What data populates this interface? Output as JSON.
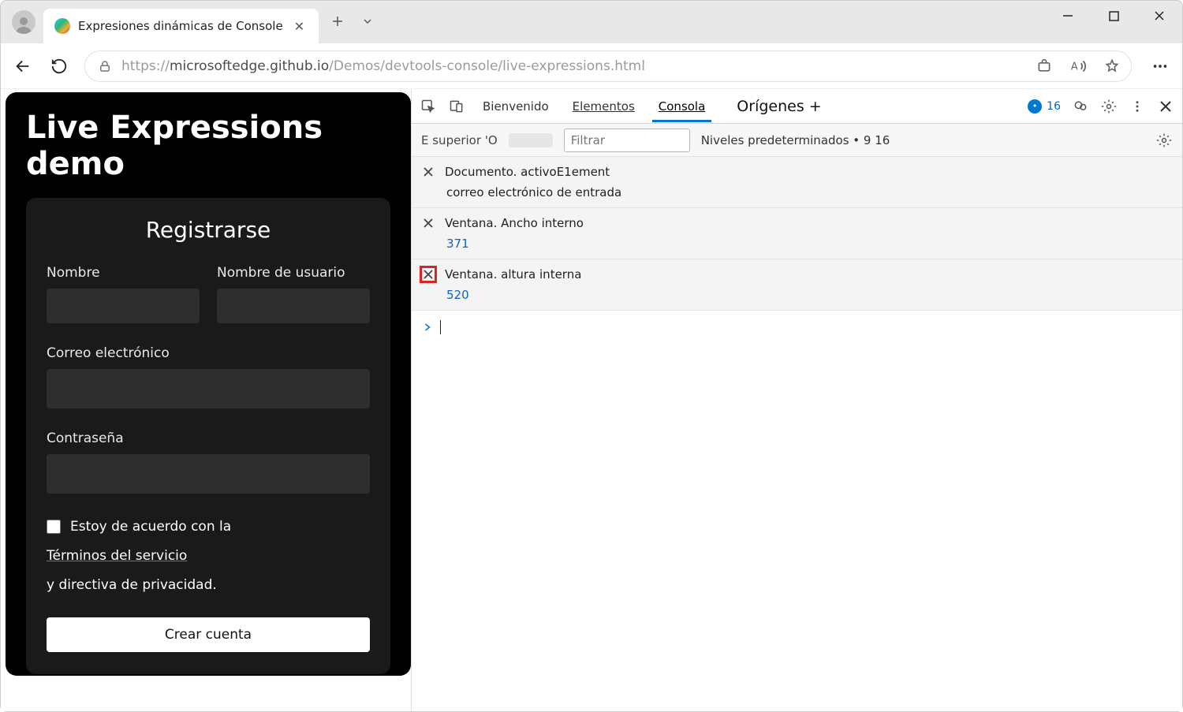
{
  "tab": {
    "title": "Expresiones dinámicas de Console"
  },
  "url": {
    "prefix": "https://",
    "host": "microsoftedge.github.io",
    "path": "/Demos/devtools-console/live-expressions.html"
  },
  "page": {
    "title": "Live Expressions demo",
    "card_title": "Registrarse",
    "fields": {
      "name_label": "Nombre",
      "username_label": "Nombre de usuario",
      "email_label": "Correo electrónico",
      "password_label": "Contraseña"
    },
    "agree": {
      "prefix": "Estoy de acuerdo con la",
      "link": "Términos del servicio",
      "suffix": "y directiva de privacidad."
    },
    "submit_label": "Crear cuenta"
  },
  "devtools": {
    "tabs": {
      "welcome": "Bienvenido",
      "elements": "Elementos",
      "console": "Consola",
      "sources": "Orígenes",
      "plus": "+"
    },
    "message_count": "16",
    "toolbar": {
      "context": "E superior 'O",
      "filter_placeholder": "Filtrar",
      "levels": "Niveles predeterminados • 9 16"
    },
    "live": [
      {
        "expr": "Documento. activoE1ement",
        "value": "correo electrónico de entrada",
        "value_class": "",
        "hl": false
      },
      {
        "expr": "Ventana. Ancho interno",
        "value": "371",
        "value_class": "blue",
        "hl": false
      },
      {
        "expr": "Ventana. altura interna",
        "value": "520",
        "value_class": "blue",
        "hl": true
      }
    ]
  }
}
